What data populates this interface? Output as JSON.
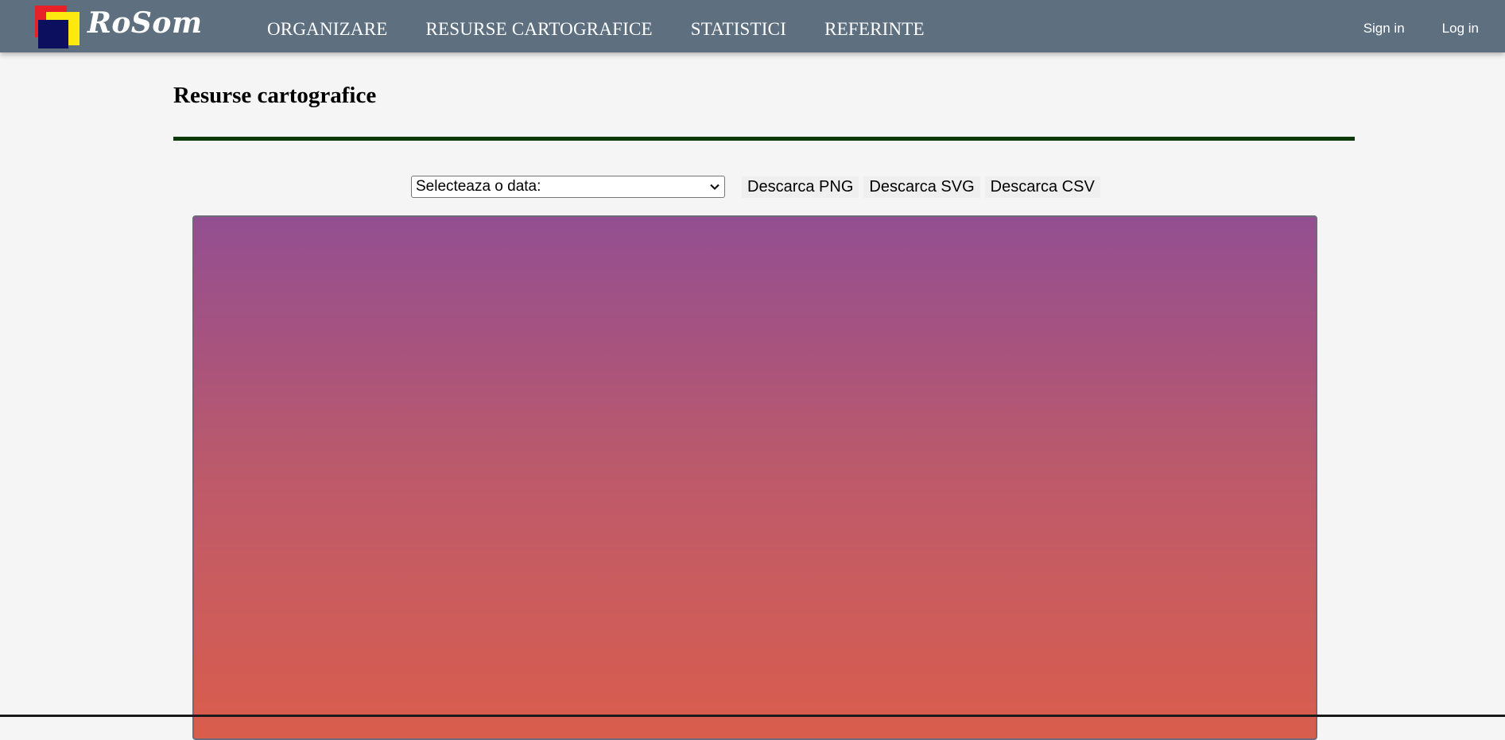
{
  "brand": {
    "name": "RoSom",
    "colors": [
      "#e8202a",
      "#fde910",
      "#0b0f5e"
    ]
  },
  "nav": {
    "items": [
      {
        "label": "ORGANIZARE"
      },
      {
        "label": "RESURSE CARTOGRAFICE"
      },
      {
        "label": "STATISTICI"
      },
      {
        "label": "REFERINTE"
      }
    ],
    "sign_in": "Sign in",
    "log_in": "Log in",
    "background": "#5e6f80"
  },
  "page": {
    "title": "Resurse cartografice",
    "rule_color": "#0e3a0b"
  },
  "controls": {
    "date_select": {
      "selected": "Selecteaza o data:",
      "icon": "chevron-down-icon"
    },
    "download_png": "Descarca PNG",
    "download_svg": "Descarca SVG",
    "download_csv": "Descarca CSV"
  },
  "map": {
    "gradient": [
      "#934f91",
      "#d95d4b"
    ]
  }
}
